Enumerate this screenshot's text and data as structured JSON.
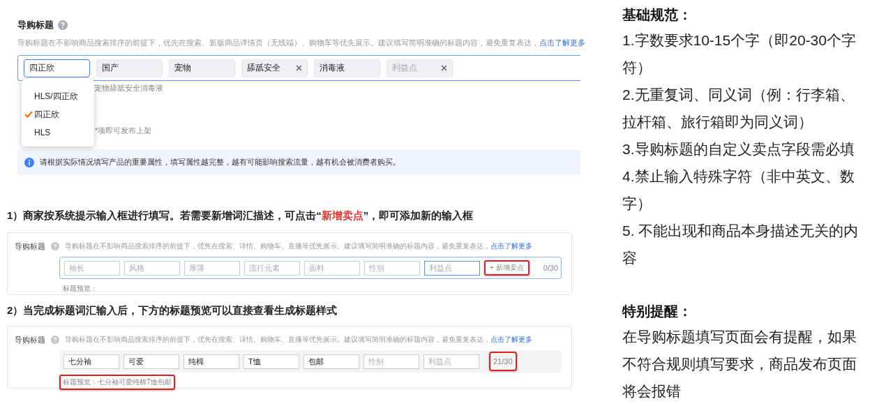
{
  "top_panel": {
    "label": "导购标题",
    "description": "导购标题在不影响商品搜索排序的前提下，优先在搜索、新版商品详情页（无线端）、购物车等优先展示。建议填写简明准确的标题内容，避免重复表达，",
    "link": "点击了解更多",
    "tags": [
      {
        "value": "四正欣",
        "focused": true,
        "removable": false
      },
      {
        "value": "国产",
        "focused": false,
        "removable": false
      },
      {
        "value": "宠物",
        "focused": false,
        "removable": false
      },
      {
        "value": "舔舐安全",
        "focused": false,
        "removable": true
      },
      {
        "value": "消毒液",
        "focused": false,
        "removable": false
      },
      {
        "placeholder": "利益点",
        "focused": false,
        "removable": true
      }
    ],
    "preview_fragment": "宠物舔舐安全消毒液",
    "publish_note": "*项即可发布上架",
    "dropdown": [
      {
        "label": "HLS/四正欣",
        "selected": false
      },
      {
        "label": "四正欣",
        "selected": true
      },
      {
        "label": "HLS",
        "selected": false
      }
    ],
    "info": "请根据实际情况填写产品的重要属性，填写属性越完整，越有可能影响搜索流量，越有机会被消费者购买。"
  },
  "steps": [
    {
      "caption": {
        "before": "1）商家按系统提示输入框进行填写。若需要新增词汇描述，可点击“",
        "highlight": "新增卖点",
        "after": "”，即可添加新的输入框"
      },
      "label": "导购标题",
      "description": "导购标题在不影响商品搜索排序的前提下，优先在搜索、详情、购物车、直播等优先展示。建议填写简明准确的标题内容，避免重复表达，",
      "link": "点击了解更多",
      "fields": [
        {
          "placeholder": "袖长",
          "focused": false
        },
        {
          "placeholder": "风格",
          "focused": false
        },
        {
          "placeholder": "厚薄",
          "focused": false
        },
        {
          "placeholder": "流行元素",
          "focused": false
        },
        {
          "placeholder": "面料",
          "focused": false
        },
        {
          "placeholder": "性别",
          "focused": false
        },
        {
          "placeholder": "利益点",
          "focused": true
        }
      ],
      "add_button": {
        "label": "+ 新增卖点",
        "highlighted": true
      },
      "counter": {
        "text": "0/30",
        "highlighted": false
      },
      "preview": {
        "text": "标题预览：",
        "highlighted": false
      }
    },
    {
      "caption": {
        "before": "2）当完成标题词汇输入后，下方的标题预览可以直接查看生成标题样式"
      },
      "label": "导购标题",
      "description": "导购标题在不影响商品搜索排序的前提下，优先在搜索、详情、购物车、直播等优先展示。建议填写简明准确的标题内容，避免重复表达，",
      "link": "点击了解更多",
      "fields": [
        {
          "value": "七分袖",
          "focused": false
        },
        {
          "value": "可爱",
          "focused": false
        },
        {
          "value": "纯棉",
          "focused": false
        },
        {
          "value": "T恤",
          "focused": false
        },
        {
          "value": "包邮",
          "focused": false
        },
        {
          "placeholder": "性别",
          "focused": false
        },
        {
          "placeholder": "利益点",
          "focused": false
        }
      ],
      "counter": {
        "text": "21/30",
        "highlighted": true
      },
      "preview": {
        "text": "标题预览：七分袖可爱纯棉T恤包邮",
        "highlighted": true
      }
    }
  ],
  "guidelines": {
    "title": "基础规范：",
    "items": [
      "1.字数要求10-15个字（即20-30个字符）",
      "2.无重复词、同义词（例：行李箱、拉杆箱、旅行箱即为同义词）",
      "3.导购标题的自定义卖点字段需必填",
      "4.禁止输入特殊字符（非中英文、数字）",
      "5. 不能出现和商品本身描述无关的内容"
    ]
  },
  "reminder": {
    "title": "特别提醒：",
    "text": "在导购标题填写页面会有提醒，如果不符合规则填写要求，商品发布页面将会报错"
  }
}
